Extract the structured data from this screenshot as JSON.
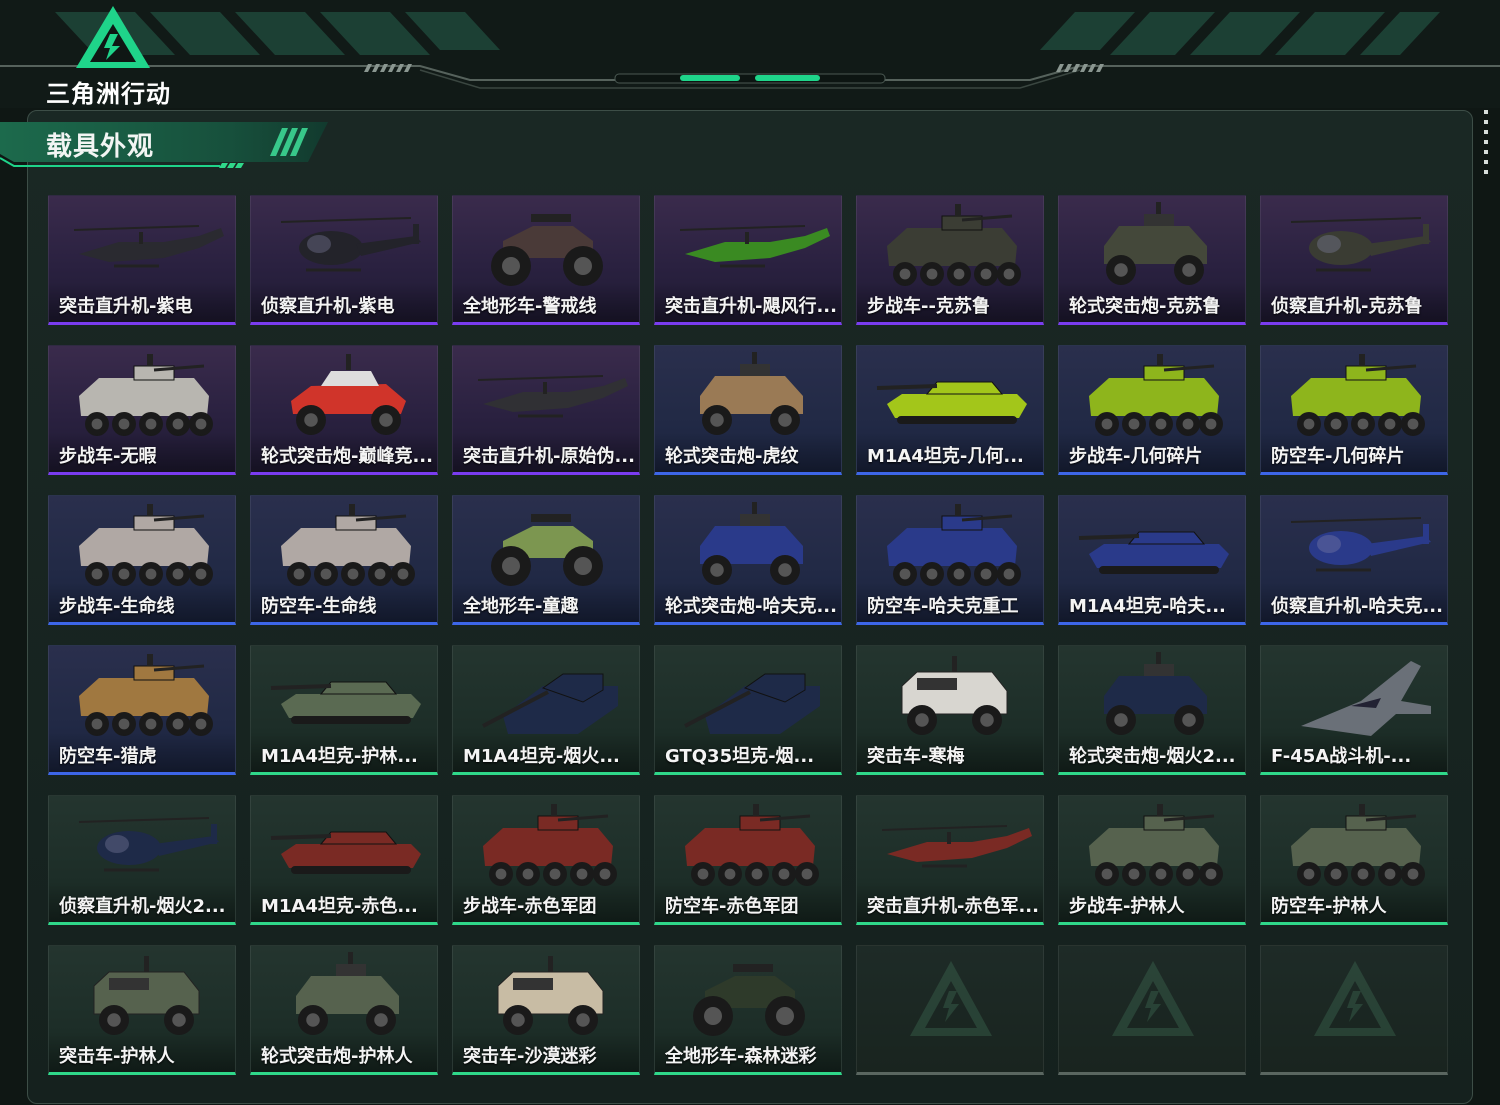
{
  "app": {
    "brand": "三角洲行动"
  },
  "section": {
    "title": "载具外观"
  },
  "colors": {
    "purple": "#7a3cf0",
    "blue": "#3d66e8",
    "green": "#2fd88a",
    "accent": "#1fd48a"
  },
  "items": [
    {
      "name": "突击直升机-紫电",
      "rarity": "purple",
      "type": "heli",
      "paint": "#2a2a30"
    },
    {
      "name": "侦察直升机-紫电",
      "rarity": "purple",
      "type": "smallheli",
      "paint": "#23232a"
    },
    {
      "name": "全地形车-警戒线",
      "rarity": "purple",
      "type": "atv",
      "paint": "#4a3a38"
    },
    {
      "name": "突击直升机-飓风行...",
      "rarity": "purple",
      "type": "heli",
      "paint": "#3a8a22"
    },
    {
      "name": "步战车--克苏鲁",
      "rarity": "purple",
      "type": "ifv",
      "paint": "#3b3d34"
    },
    {
      "name": "轮式突击炮-克苏鲁",
      "rarity": "purple",
      "type": "wheeled",
      "paint": "#44483a"
    },
    {
      "name": "侦察直升机-克苏鲁",
      "rarity": "purple",
      "type": "smallheli",
      "paint": "#3a3c33"
    },
    {
      "name": "步战车-无暇",
      "rarity": "purple",
      "type": "ifv",
      "paint": "#b8b6b0"
    },
    {
      "name": "轮式突击炮-巅峰竞...",
      "rarity": "purple",
      "type": "buggy",
      "paint": "#d0342a"
    },
    {
      "name": "突击直升机-原始伪...",
      "rarity": "purple",
      "type": "heli",
      "paint": "#303034"
    },
    {
      "name": "轮式突击炮-虎纹",
      "rarity": "blue",
      "type": "wheeled",
      "paint": "#9a7a55"
    },
    {
      "name": "M1A4坦克-几何...",
      "rarity": "blue",
      "type": "tank",
      "paint": "#a3c61a"
    },
    {
      "name": "步战车-几何碎片",
      "rarity": "blue",
      "type": "ifv",
      "paint": "#8eb51c"
    },
    {
      "name": "防空车-几何碎片",
      "rarity": "blue",
      "type": "ifv",
      "paint": "#8eb51c"
    },
    {
      "name": "步战车-生命线",
      "rarity": "blue",
      "type": "ifv",
      "paint": "#b0a8a4"
    },
    {
      "name": "防空车-生命线",
      "rarity": "blue",
      "type": "ifv",
      "paint": "#b0a8a4"
    },
    {
      "name": "全地形车-童趣",
      "rarity": "blue",
      "type": "atv",
      "paint": "#7c9650"
    },
    {
      "name": "轮式突击炮-哈夫克...",
      "rarity": "blue",
      "type": "wheeled",
      "paint": "#2a3a8a"
    },
    {
      "name": "防空车-哈夫克重工",
      "rarity": "blue",
      "type": "ifv",
      "paint": "#2a3a8a"
    },
    {
      "name": "M1A4坦克-哈夫...",
      "rarity": "blue",
      "type": "tank",
      "paint": "#2a3a8a"
    },
    {
      "name": "侦察直升机-哈夫克...",
      "rarity": "blue",
      "type": "smallheli",
      "paint": "#2a3a8a"
    },
    {
      "name": "防空车-猎虎",
      "rarity": "blue",
      "type": "ifv",
      "paint": "#a07840"
    },
    {
      "name": "M1A4坦克-护林...",
      "rarity": "green",
      "type": "tank",
      "paint": "#5a6a52"
    },
    {
      "name": "M1A4坦克-烟火...",
      "rarity": "green",
      "type": "tankangle",
      "paint": "#1e2a48"
    },
    {
      "name": "GTQ35坦克-烟...",
      "rarity": "green",
      "type": "tankangle",
      "paint": "#1e2a48"
    },
    {
      "name": "突击车-寒梅",
      "rarity": "green",
      "type": "truck",
      "paint": "#d8d6d0"
    },
    {
      "name": "轮式突击炮-烟火2...",
      "rarity": "green",
      "type": "wheeled",
      "paint": "#1e2a48"
    },
    {
      "name": "F-45A战斗机-...",
      "rarity": "green",
      "type": "jet",
      "paint": "#6a7078"
    },
    {
      "name": "侦察直升机-烟火2...",
      "rarity": "green",
      "type": "smallheli",
      "paint": "#1e2a48"
    },
    {
      "name": "M1A4坦克-赤色...",
      "rarity": "green",
      "type": "tank",
      "paint": "#7a2a24"
    },
    {
      "name": "步战车-赤色军团",
      "rarity": "green",
      "type": "ifv",
      "paint": "#7a2a24"
    },
    {
      "name": "防空车-赤色军团",
      "rarity": "green",
      "type": "ifv",
      "paint": "#7a2a24"
    },
    {
      "name": "突击直升机-赤色军...",
      "rarity": "green",
      "type": "heli",
      "paint": "#7a2a24"
    },
    {
      "name": "步战车-护林人",
      "rarity": "green",
      "type": "ifv",
      "paint": "#56624e"
    },
    {
      "name": "防空车-护林人",
      "rarity": "green",
      "type": "ifv",
      "paint": "#56624e"
    },
    {
      "name": "突击车-护林人",
      "rarity": "green",
      "type": "truck",
      "paint": "#56624e"
    },
    {
      "name": "轮式突击炮-护林人",
      "rarity": "green",
      "type": "wheeled",
      "paint": "#56624e"
    },
    {
      "name": "突击车-沙漠迷彩",
      "rarity": "green",
      "type": "truck",
      "paint": "#c8bca4"
    },
    {
      "name": "全地形车-森林迷彩",
      "rarity": "green",
      "type": "atv",
      "paint": "#2e3a2a"
    },
    {
      "name": "",
      "rarity": "empty",
      "type": "empty",
      "paint": ""
    },
    {
      "name": "",
      "rarity": "empty",
      "type": "empty",
      "paint": ""
    },
    {
      "name": "",
      "rarity": "empty",
      "type": "empty",
      "paint": ""
    }
  ]
}
